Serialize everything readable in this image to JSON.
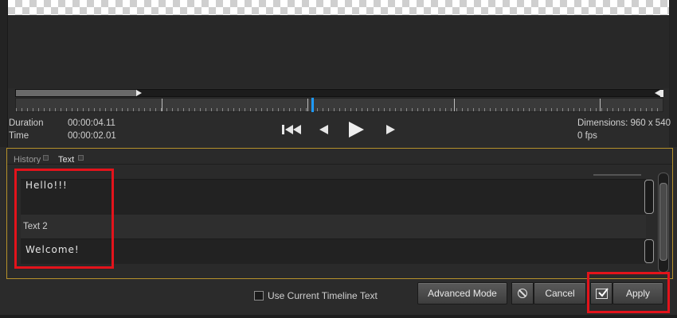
{
  "info": {
    "duration_label": "Duration",
    "duration_value": "00:00:04.11",
    "time_label": "Time",
    "time_value": "00:00:02.01",
    "dimensions": "Dimensions: 960 x 540",
    "fps": "0 fps"
  },
  "tabs": [
    {
      "label": "History",
      "active": false
    },
    {
      "label": "Text",
      "active": true
    }
  ],
  "text_fields": [
    {
      "label": "",
      "value": "Hello!!!"
    },
    {
      "label": "Text 2",
      "value": "Welcome!"
    }
  ],
  "footer": {
    "use_timeline_text_label": "Use Current Timeline Text",
    "advanced_mode_label": "Advanced Mode",
    "cancel_label": "Cancel",
    "apply_label": "Apply"
  },
  "colors": {
    "highlight": "#e3131b",
    "panel_border": "#b5912b",
    "playhead": "#1e9bff"
  },
  "icons": {
    "first_frame": "skip-to-start-icon",
    "prev_frame": "step-back-icon",
    "play": "play-icon",
    "next_frame": "step-forward-icon",
    "cancel": "cancel-circle-icon",
    "apply": "apply-check-icon"
  }
}
